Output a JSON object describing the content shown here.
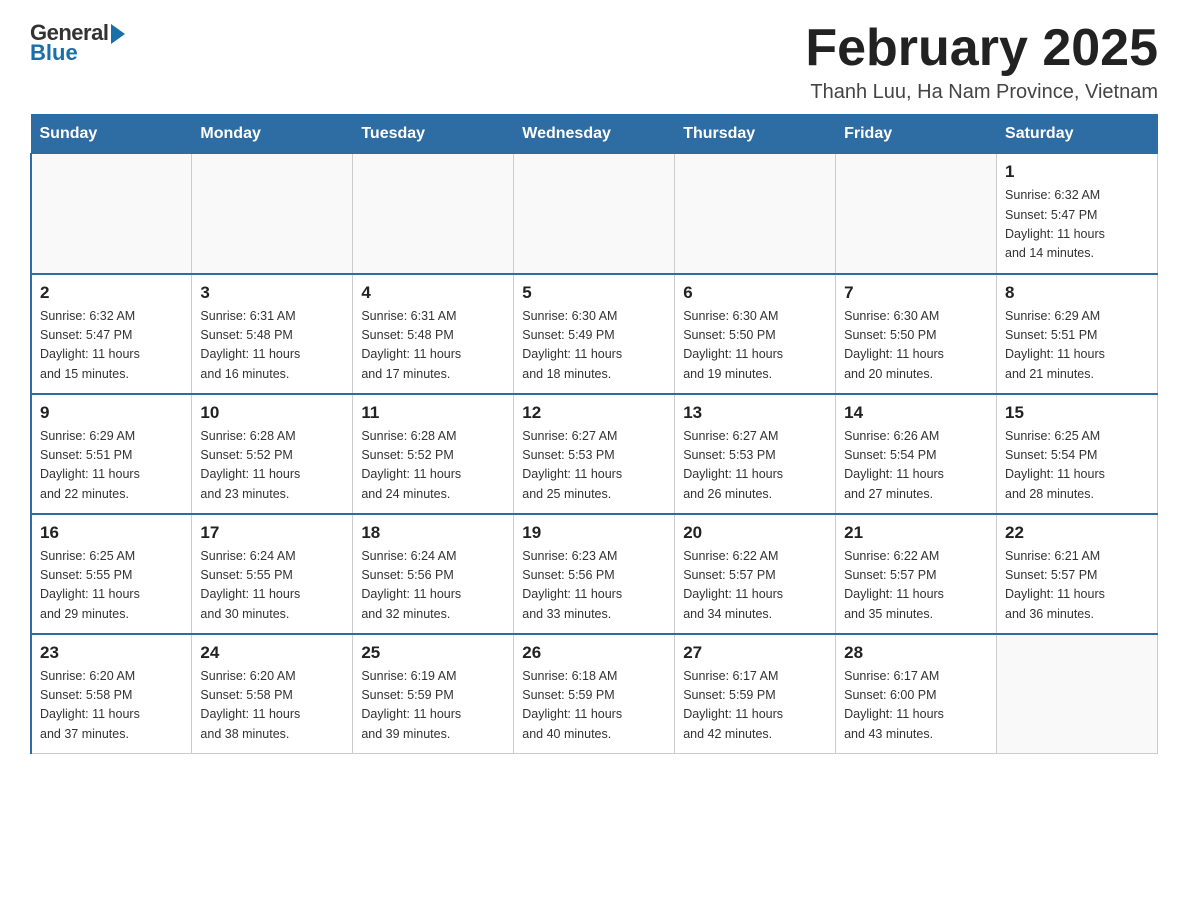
{
  "header": {
    "logo_general": "General",
    "logo_blue": "Blue",
    "month_title": "February 2025",
    "location": "Thanh Luu, Ha Nam Province, Vietnam"
  },
  "weekdays": [
    "Sunday",
    "Monday",
    "Tuesday",
    "Wednesday",
    "Thursday",
    "Friday",
    "Saturday"
  ],
  "weeks": [
    [
      {
        "day": "",
        "info": ""
      },
      {
        "day": "",
        "info": ""
      },
      {
        "day": "",
        "info": ""
      },
      {
        "day": "",
        "info": ""
      },
      {
        "day": "",
        "info": ""
      },
      {
        "day": "",
        "info": ""
      },
      {
        "day": "1",
        "info": "Sunrise: 6:32 AM\nSunset: 5:47 PM\nDaylight: 11 hours\nand 14 minutes."
      }
    ],
    [
      {
        "day": "2",
        "info": "Sunrise: 6:32 AM\nSunset: 5:47 PM\nDaylight: 11 hours\nand 15 minutes."
      },
      {
        "day": "3",
        "info": "Sunrise: 6:31 AM\nSunset: 5:48 PM\nDaylight: 11 hours\nand 16 minutes."
      },
      {
        "day": "4",
        "info": "Sunrise: 6:31 AM\nSunset: 5:48 PM\nDaylight: 11 hours\nand 17 minutes."
      },
      {
        "day": "5",
        "info": "Sunrise: 6:30 AM\nSunset: 5:49 PM\nDaylight: 11 hours\nand 18 minutes."
      },
      {
        "day": "6",
        "info": "Sunrise: 6:30 AM\nSunset: 5:50 PM\nDaylight: 11 hours\nand 19 minutes."
      },
      {
        "day": "7",
        "info": "Sunrise: 6:30 AM\nSunset: 5:50 PM\nDaylight: 11 hours\nand 20 minutes."
      },
      {
        "day": "8",
        "info": "Sunrise: 6:29 AM\nSunset: 5:51 PM\nDaylight: 11 hours\nand 21 minutes."
      }
    ],
    [
      {
        "day": "9",
        "info": "Sunrise: 6:29 AM\nSunset: 5:51 PM\nDaylight: 11 hours\nand 22 minutes."
      },
      {
        "day": "10",
        "info": "Sunrise: 6:28 AM\nSunset: 5:52 PM\nDaylight: 11 hours\nand 23 minutes."
      },
      {
        "day": "11",
        "info": "Sunrise: 6:28 AM\nSunset: 5:52 PM\nDaylight: 11 hours\nand 24 minutes."
      },
      {
        "day": "12",
        "info": "Sunrise: 6:27 AM\nSunset: 5:53 PM\nDaylight: 11 hours\nand 25 minutes."
      },
      {
        "day": "13",
        "info": "Sunrise: 6:27 AM\nSunset: 5:53 PM\nDaylight: 11 hours\nand 26 minutes."
      },
      {
        "day": "14",
        "info": "Sunrise: 6:26 AM\nSunset: 5:54 PM\nDaylight: 11 hours\nand 27 minutes."
      },
      {
        "day": "15",
        "info": "Sunrise: 6:25 AM\nSunset: 5:54 PM\nDaylight: 11 hours\nand 28 minutes."
      }
    ],
    [
      {
        "day": "16",
        "info": "Sunrise: 6:25 AM\nSunset: 5:55 PM\nDaylight: 11 hours\nand 29 minutes."
      },
      {
        "day": "17",
        "info": "Sunrise: 6:24 AM\nSunset: 5:55 PM\nDaylight: 11 hours\nand 30 minutes."
      },
      {
        "day": "18",
        "info": "Sunrise: 6:24 AM\nSunset: 5:56 PM\nDaylight: 11 hours\nand 32 minutes."
      },
      {
        "day": "19",
        "info": "Sunrise: 6:23 AM\nSunset: 5:56 PM\nDaylight: 11 hours\nand 33 minutes."
      },
      {
        "day": "20",
        "info": "Sunrise: 6:22 AM\nSunset: 5:57 PM\nDaylight: 11 hours\nand 34 minutes."
      },
      {
        "day": "21",
        "info": "Sunrise: 6:22 AM\nSunset: 5:57 PM\nDaylight: 11 hours\nand 35 minutes."
      },
      {
        "day": "22",
        "info": "Sunrise: 6:21 AM\nSunset: 5:57 PM\nDaylight: 11 hours\nand 36 minutes."
      }
    ],
    [
      {
        "day": "23",
        "info": "Sunrise: 6:20 AM\nSunset: 5:58 PM\nDaylight: 11 hours\nand 37 minutes."
      },
      {
        "day": "24",
        "info": "Sunrise: 6:20 AM\nSunset: 5:58 PM\nDaylight: 11 hours\nand 38 minutes."
      },
      {
        "day": "25",
        "info": "Sunrise: 6:19 AM\nSunset: 5:59 PM\nDaylight: 11 hours\nand 39 minutes."
      },
      {
        "day": "26",
        "info": "Sunrise: 6:18 AM\nSunset: 5:59 PM\nDaylight: 11 hours\nand 40 minutes."
      },
      {
        "day": "27",
        "info": "Sunrise: 6:17 AM\nSunset: 5:59 PM\nDaylight: 11 hours\nand 42 minutes."
      },
      {
        "day": "28",
        "info": "Sunrise: 6:17 AM\nSunset: 6:00 PM\nDaylight: 11 hours\nand 43 minutes."
      },
      {
        "day": "",
        "info": ""
      }
    ]
  ]
}
